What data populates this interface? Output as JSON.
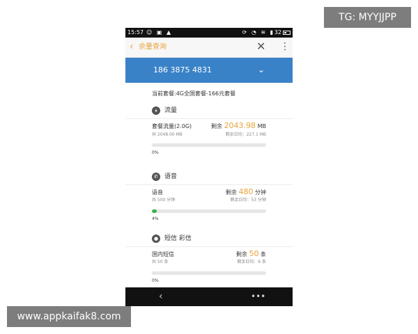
{
  "watermarks": {
    "tg": "TG: MYYJJPP",
    "site": "www.appkaifak8.com"
  },
  "status_bar": {
    "time": "15:57",
    "signal": "32"
  },
  "app_bar": {
    "title": "余量查询"
  },
  "phone_number": "186 3875 4831",
  "plan": "当前套餐:4G全国套餐-166元套餐",
  "sections": [
    {
      "title": "流量",
      "icon": "data-usage-icon",
      "item": {
        "name": "套餐流量(2.0G)",
        "remaining_label": "剩余",
        "remaining_value": "2043.98",
        "remaining_unit": "MB",
        "total": "共 2048.00 MB",
        "daily_avg": "剩余日均：227.1 MB",
        "progress_percent": 0,
        "progress_label": "0%"
      }
    },
    {
      "title": "语音",
      "icon": "phone-icon",
      "item": {
        "name": "语音",
        "remaining_label": "剩余",
        "remaining_value": "480",
        "remaining_unit": "分钟",
        "total": "共 500 分钟",
        "daily_avg": "剩余日均：53 分钟",
        "progress_percent": 4,
        "progress_label": "4%"
      }
    },
    {
      "title": "短信 彩信",
      "icon": "person-icon",
      "item": {
        "name": "国内短信",
        "remaining_label": "剩余",
        "remaining_value": "50",
        "remaining_unit": "条",
        "total": "共 50 条",
        "daily_avg": "剩余日均：6 条",
        "progress_percent": 0,
        "progress_label": "0%"
      }
    }
  ],
  "colors": {
    "accent": "#e8a33a",
    "header_blue": "#3a82c8",
    "progress": "#35b34a"
  }
}
